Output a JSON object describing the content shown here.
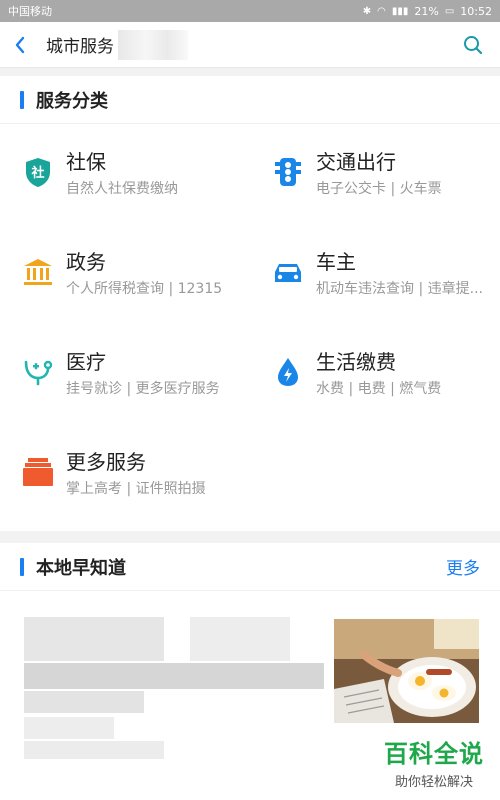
{
  "status": {
    "carrier": "中国移动",
    "battery": "21%",
    "time": "10:52"
  },
  "header": {
    "title": "城市服务"
  },
  "services_section": {
    "title": "服务分类",
    "items": [
      {
        "title": "社保",
        "subtitle": "自然人社保费缴纳",
        "icon": "social-security-shield-icon",
        "color": "#1aa59a"
      },
      {
        "title": "交通出行",
        "subtitle": "电子公交卡 | 火车票",
        "icon": "traffic-light-icon",
        "color": "#1a86e8"
      },
      {
        "title": "政务",
        "subtitle": "个人所得税查询 | 12315",
        "icon": "government-building-icon",
        "color": "#f0a51c"
      },
      {
        "title": "车主",
        "subtitle": "机动车违法查询 | 违章提...",
        "icon": "car-icon",
        "color": "#1a86e8"
      },
      {
        "title": "医疗",
        "subtitle": "挂号就诊 | 更多医疗服务",
        "icon": "medical-stethoscope-icon",
        "color": "#1fb6b0"
      },
      {
        "title": "生活缴费",
        "subtitle": "水费 | 电费 | 燃气费",
        "icon": "water-drop-bolt-icon",
        "color": "#1a86e8"
      },
      {
        "title": "更多服务",
        "subtitle": "掌上高考 | 证件照拍摄",
        "icon": "more-services-box-icon",
        "color": "#ef5a2e"
      }
    ]
  },
  "local_section": {
    "title": "本地早知道",
    "more_label": "更多"
  },
  "watermark": {
    "main": "百科全说",
    "sub": "助你轻松解决"
  }
}
